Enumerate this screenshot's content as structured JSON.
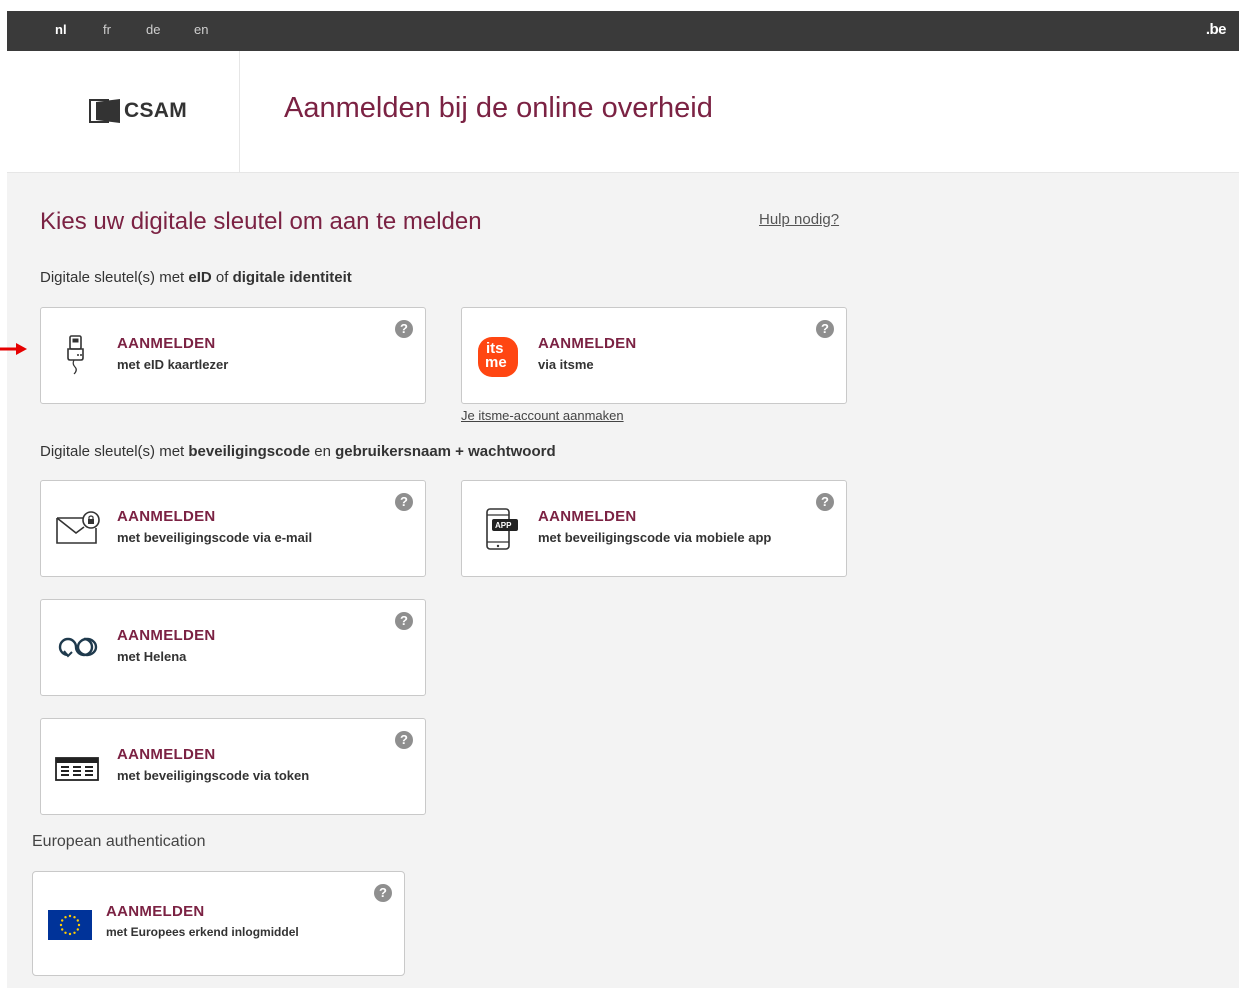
{
  "languages": [
    {
      "label": "nl",
      "active": true
    },
    {
      "label": "fr",
      "active": false
    },
    {
      "label": "de",
      "active": false
    },
    {
      "label": "en",
      "active": false
    }
  ],
  "topbar": {
    "domain_badge": ".be"
  },
  "header": {
    "logo_text": "CSAM",
    "title": "Aanmelden bij de online overheid"
  },
  "main": {
    "title": "Kies uw digitale sleutel om aan te melden",
    "help_link": "Hulp nodig?",
    "group1": {
      "prefix": "Digitale sleutel(s) met ",
      "strong1": "eID",
      "mid": " of ",
      "strong2": "digitale identiteit"
    },
    "group2": {
      "prefix": "Digitale sleutel(s) met ",
      "strong1": "beveiligingscode",
      "mid": " en ",
      "strong2": "gebruikersnaam + wachtwoord"
    },
    "itsme_account_link": "Je itsme-account aanmaken",
    "european_label": "European authentication",
    "help_icon_glyph": "?",
    "cards": {
      "eid": {
        "title": "AANMELDEN",
        "sub": "met eID kaartlezer",
        "icon": "card-reader-icon"
      },
      "itsme": {
        "title": "AANMELDEN",
        "sub": "via itsme",
        "icon": "itsme-logo",
        "logo_line1": "its",
        "logo_line2": "me"
      },
      "email": {
        "title": "AANMELDEN",
        "sub": "met beveiligingscode via e-mail",
        "icon": "envelope-lock-icon"
      },
      "mobile": {
        "title": "AANMELDEN",
        "sub": "met beveiligingscode via mobiele app",
        "icon": "mobile-app-icon",
        "app_badge": "APP"
      },
      "helena": {
        "title": "AANMELDEN",
        "sub": "met Helena",
        "icon": "helena-icon"
      },
      "token": {
        "title": "AANMELDEN",
        "sub": "met beveiligingscode via token",
        "icon": "token-grid-icon"
      },
      "eu": {
        "title": "AANMELDEN",
        "sub": "met Europees erkend inlogmiddel",
        "icon": "eu-flag-icon"
      }
    }
  },
  "colors": {
    "brand": "#7b2243",
    "topbar": "#3a3a3a",
    "itsme": "#ff4612",
    "eu_blue": "#003399",
    "eu_star": "#ffcc00",
    "arrow": "#e60000"
  }
}
